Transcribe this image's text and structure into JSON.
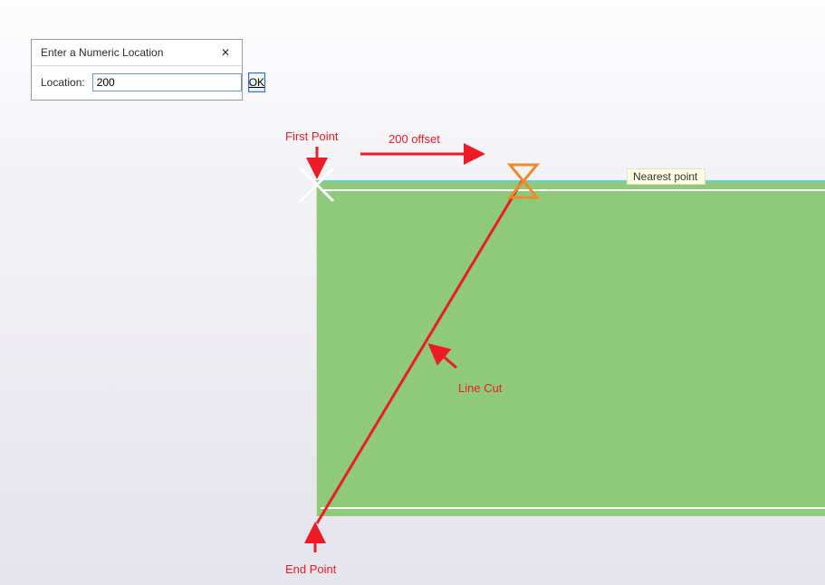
{
  "dialog": {
    "title": "Enter a Numeric Location",
    "close_glyph": "✕",
    "location_label": "Location:",
    "location_value": "200",
    "ok_label": "OK"
  },
  "annotations": {
    "first_point": "First Point",
    "offset": "200 offset",
    "line_cut": "Line Cut",
    "end_point": "End Point"
  },
  "tooltip": {
    "text": "Nearest point"
  },
  "colors": {
    "annotation": "#ed1c24",
    "panel": "#8fc97a",
    "panel_top_edge": "#5bd6c9",
    "marker": "#ef8b2c"
  }
}
